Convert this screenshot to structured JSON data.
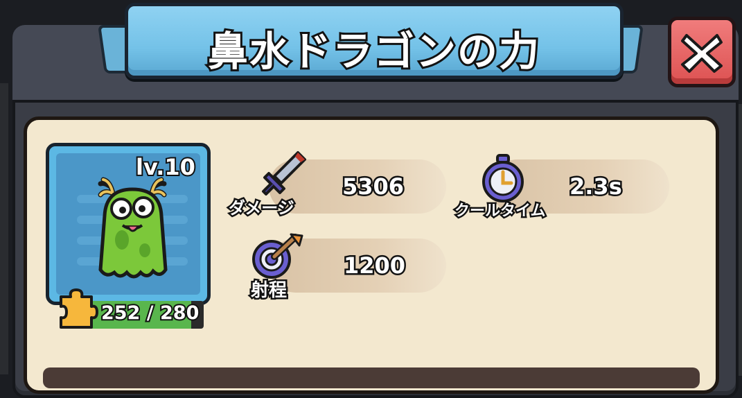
{
  "title": "鼻水ドラゴンの力",
  "close_button": {
    "icon": "close-x-icon"
  },
  "character": {
    "level": "lv.10",
    "shards": "252 / 280",
    "shard_progress": 0.9,
    "icon": "green-slime-dragon"
  },
  "stats": {
    "damage": {
      "label": "ダメージ",
      "value": "5306",
      "icon": "sword-icon"
    },
    "cooldown": {
      "label": "クールタイム",
      "value": "2.3s",
      "icon": "stopwatch-icon"
    },
    "range": {
      "label": "射程",
      "value": "1200",
      "icon": "target-icon"
    }
  },
  "colors": {
    "ribbon": "#74c2e8",
    "close": "#dd5252",
    "content_bg": "#f3e8cf",
    "card": "#5cb8e4",
    "progress": "#59b64d"
  }
}
